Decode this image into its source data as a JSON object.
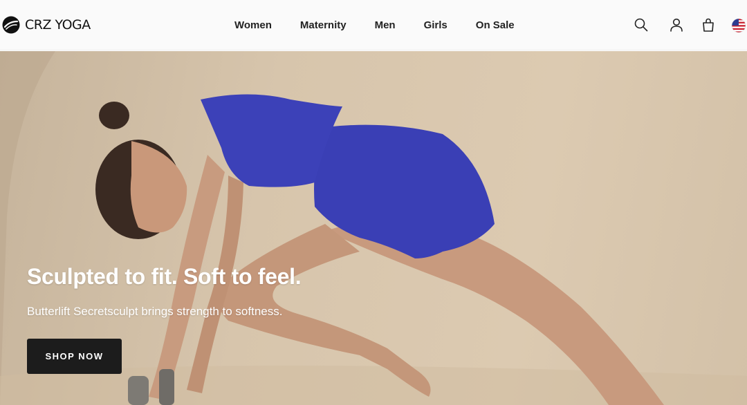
{
  "brand": {
    "name": "CRZ YOGA",
    "logo_icon": "crz-logo-icon"
  },
  "nav": {
    "items": [
      {
        "label": "Women"
      },
      {
        "label": "Maternity"
      },
      {
        "label": "Men"
      },
      {
        "label": "Girls"
      },
      {
        "label": "On Sale"
      }
    ]
  },
  "utility": {
    "icons": [
      "search-icon",
      "account-icon",
      "shopping-bag-icon",
      "us-flag-icon"
    ]
  },
  "hero": {
    "headline": "Sculpted to fit. Soft to feel.",
    "subheadline": "Butterlift Secretsculpt brings strength to softness.",
    "cta_label": "SHOP NOW",
    "image": "woman-in-blue-activewear-on-pilates-reformer",
    "colors": {
      "background": "#d7c5ac",
      "outfit": "#3a3fb5",
      "cta": "#1c1c1c"
    }
  }
}
